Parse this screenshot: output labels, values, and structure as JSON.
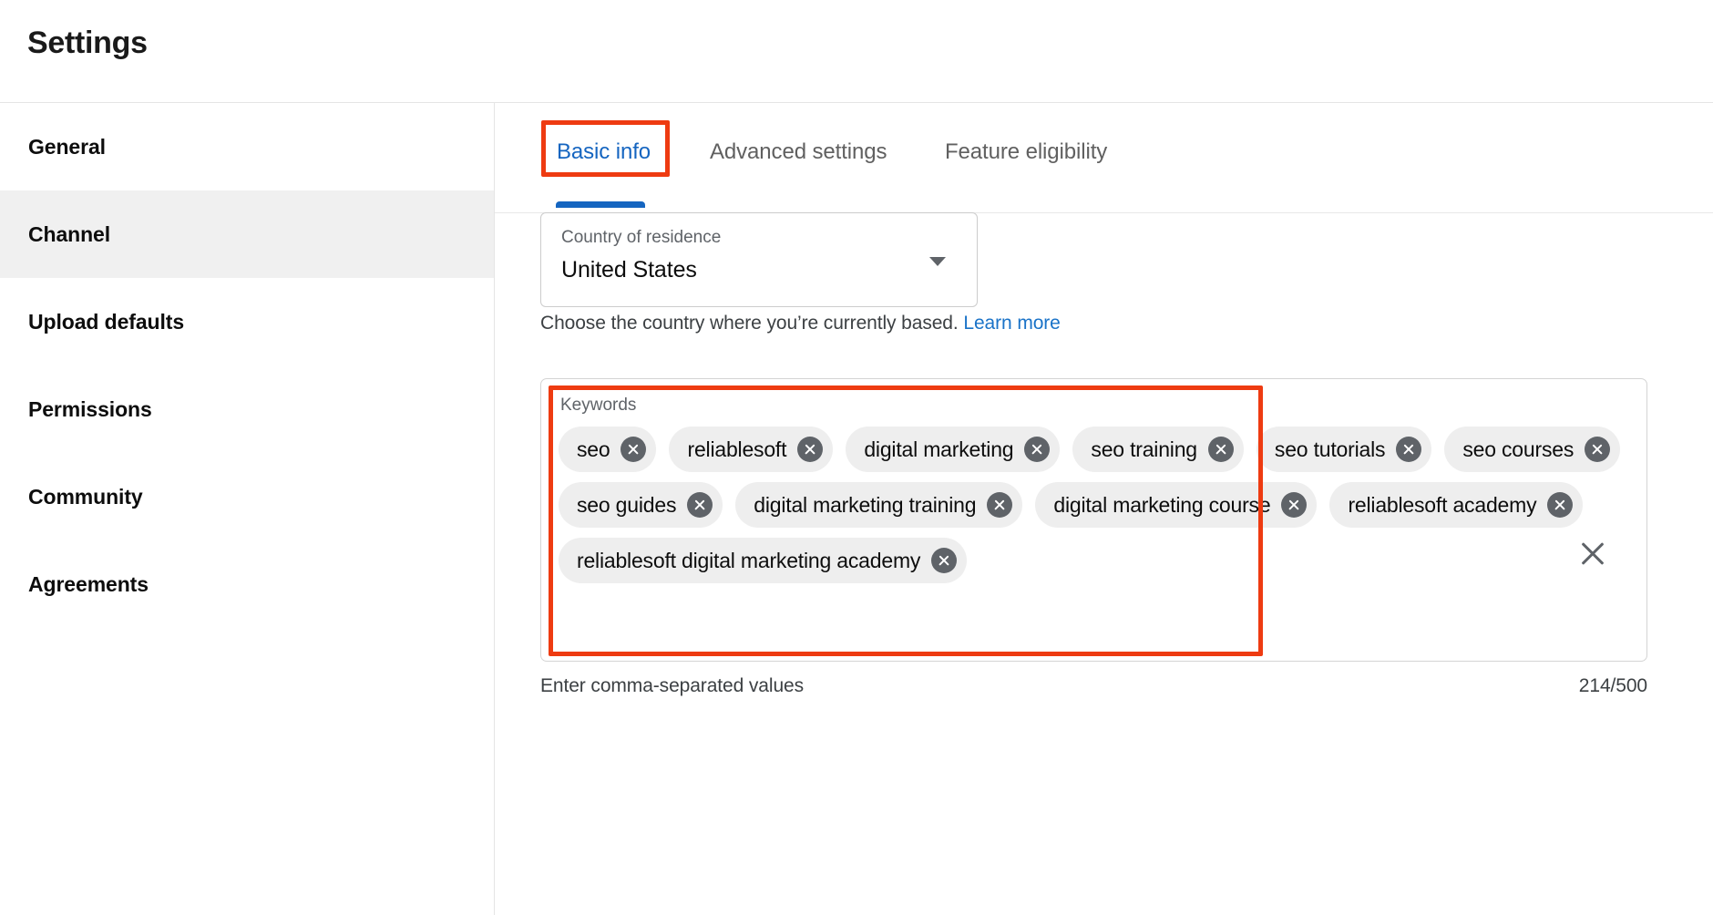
{
  "header": {
    "title": "Settings"
  },
  "sidebar": {
    "items": [
      {
        "label": "General",
        "active": false
      },
      {
        "label": "Channel",
        "active": true
      },
      {
        "label": "Upload defaults",
        "active": false
      },
      {
        "label": "Permissions",
        "active": false
      },
      {
        "label": "Community",
        "active": false
      },
      {
        "label": "Agreements",
        "active": false
      }
    ]
  },
  "main": {
    "tabs": [
      {
        "label": "Basic info",
        "active": true
      },
      {
        "label": "Advanced settings",
        "active": false
      },
      {
        "label": "Feature eligibility",
        "active": false
      }
    ],
    "country": {
      "label": "Country of residence",
      "value": "United States",
      "helper_text": "Choose the country where you’re currently based.",
      "helper_link": "Learn more",
      "chevron_icon": "chevron-down-icon"
    },
    "keywords": {
      "label": "Keywords",
      "hint": "Enter comma-separated values",
      "counter": "214/500",
      "clear_icon": "close-icon",
      "chip_remove_icon": "close-circle-icon",
      "chips": [
        "seo",
        "reliablesoft",
        "digital marketing",
        "seo training",
        "seo tutorials",
        "seo courses",
        "seo guides",
        "digital marketing training",
        "digital marketing course",
        "reliablesoft academy",
        "reliablesoft digital marketing academy"
      ]
    }
  },
  "annotations": {
    "color": "#ee3b11",
    "targets": [
      "basic-info-tab",
      "keywords-field"
    ]
  },
  "colors": {
    "accent_blue": "#1565c0",
    "link_blue": "#1a73c8",
    "chip_bg": "#eeeeee",
    "chip_icon": "#5f6368",
    "sidebar_active_bg": "#f0f0f0"
  }
}
